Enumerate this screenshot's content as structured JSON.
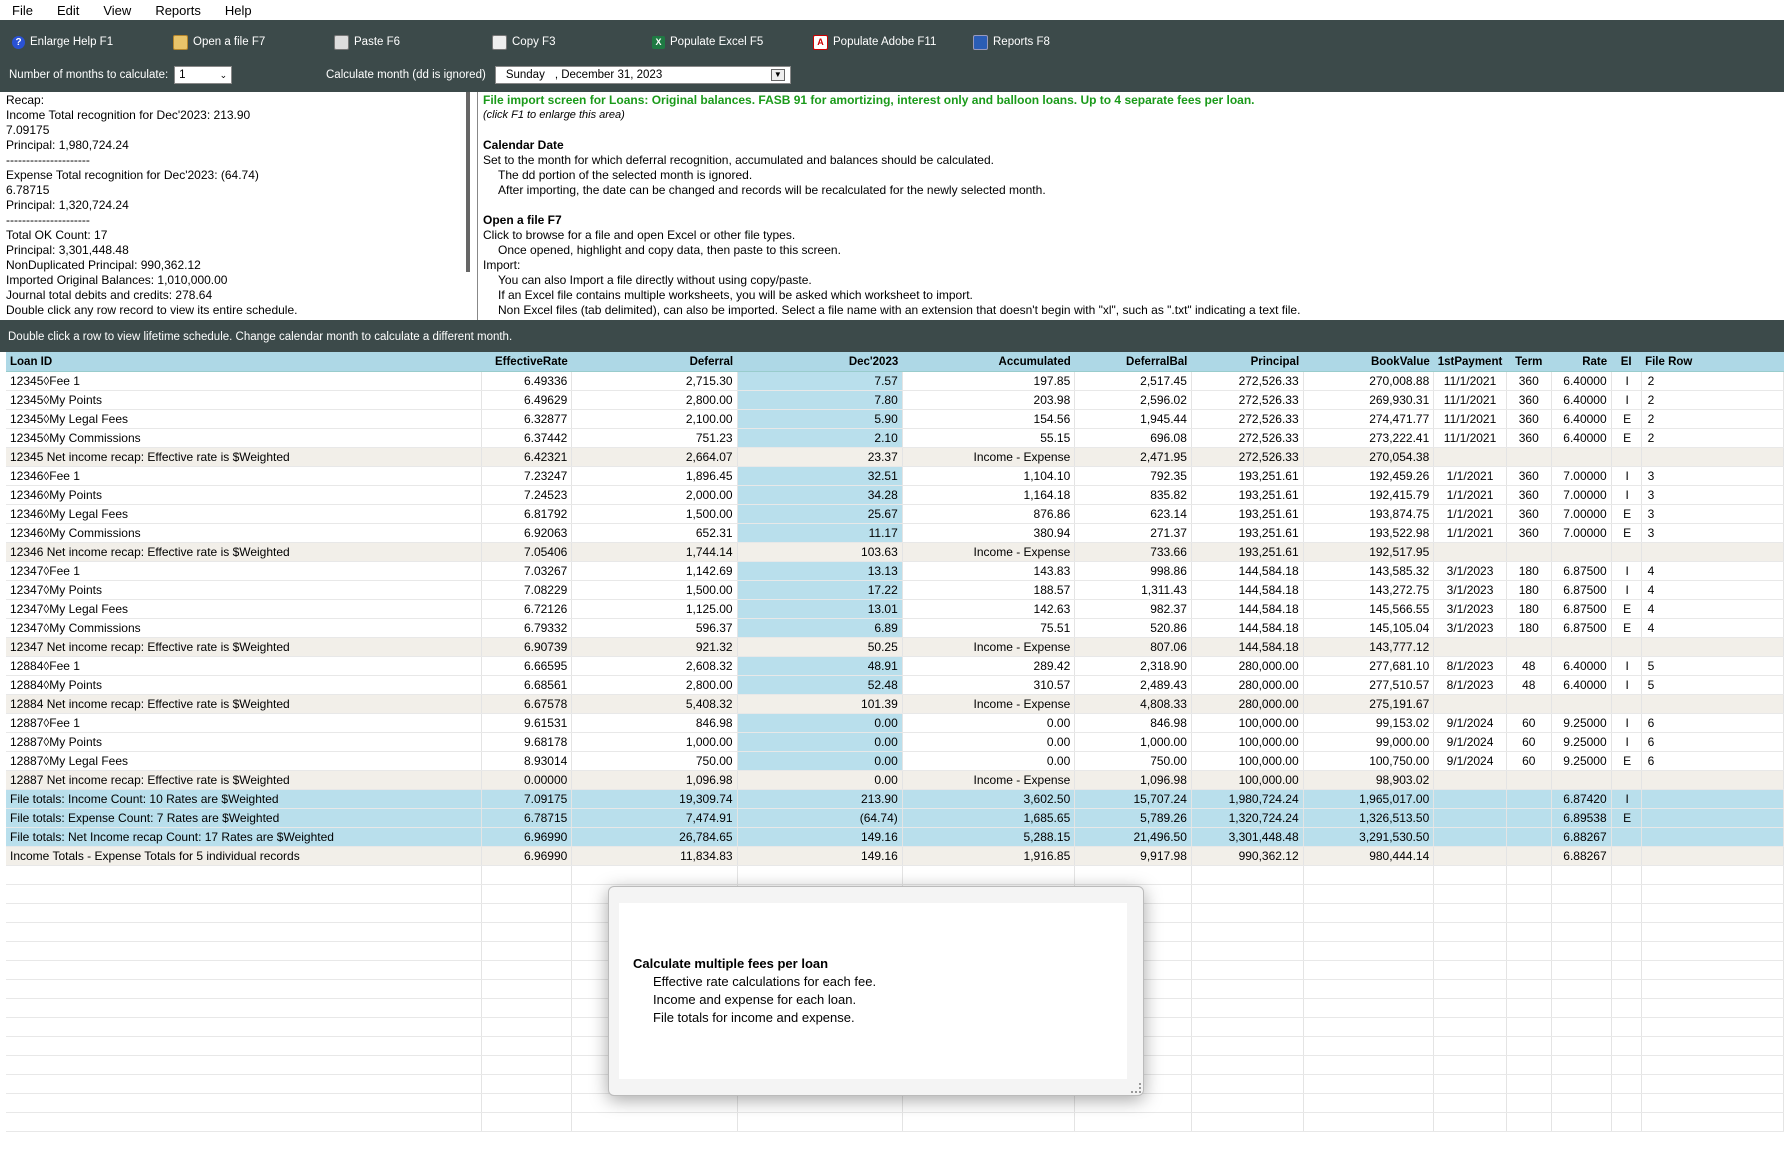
{
  "menu": [
    "File",
    "Edit",
    "View",
    "Reports",
    "Help"
  ],
  "toolbar": {
    "buttons": [
      {
        "label": "Enlarge Help  F1",
        "icon": "help-icon"
      },
      {
        "label": "Open a file  F7",
        "icon": "folder-icon"
      },
      {
        "label": "Paste  F6",
        "icon": "paste-icon"
      },
      {
        "label": "Copy  F3",
        "icon": "copy-icon"
      },
      {
        "label": "Populate Excel  F5",
        "icon": "excel-icon"
      },
      {
        "label": "Populate Adobe  F11",
        "icon": "pdf-icon"
      },
      {
        "label": "Reports  F8",
        "icon": "reports-icon"
      }
    ],
    "months_label": "Number of months to calculate:",
    "months_value": "1",
    "calc_month_label": "Calculate month (dd is ignored)",
    "calc_month_day": "Sunday",
    "calc_month_date": ", December 31, 2023"
  },
  "recap": [
    "Recap:",
    "Income Total recognition for Dec'2023: 213.90",
    "7.09175",
    "Principal: 1,980,724.24",
    "---------------------",
    "Expense Total recognition for Dec'2023: (64.74)",
    "6.78715",
    "Principal: 1,320,724.24",
    "---------------------",
    "Total OK Count: 17",
    "Principal: 3,301,448.48",
    "NonDuplicated Principal: 990,362.12",
    "Imported Original Balances: 1,010,000.00",
    "Journal total debits and credits: 278.64",
    "Double click any row record to view its entire schedule."
  ],
  "info": {
    "title": "File import screen for Loans:  Original balances.  FASB 91 for amortizing, interest only and balloon loans.  Up to 4 separate fees per loan.",
    "subtitle": "(click F1 to enlarge this area)",
    "cal_head": "Calendar Date",
    "cal_1": "Set to the month for which deferral recognition, accumulated and balances should be calculated.",
    "cal_2": "The dd portion of the selected month is ignored.",
    "cal_3": "After importing, the date can be changed and records will be recalculated for the newly selected month.",
    "open_head": "Open a file  F7",
    "open_1": "Click to browse for a file and open Excel or other file types.",
    "open_2": "Once opened, highlight and copy data, then paste to this screen.",
    "imp_head": "Import:",
    "imp_1": "You can also Import a file directly without using copy/paste.",
    "imp_2": "If an Excel file contains multiple worksheets, you will be asked which worksheet to import.",
    "imp_3": "Non Excel files (tab delimited), can also be imported.  Select a file name with an extension that doesn't begin with \"xl\", such as \".txt\" indicating a text file."
  },
  "status_text": "Double click a row to view lifetime schedule.  Change calendar month to calculate a different month.",
  "columns": [
    "Loan ID",
    "EffectiveRate",
    "Deferral",
    "Dec'2023",
    "Accumulated",
    "DeferralBal",
    "Principal",
    "BookValue",
    "1stPayment",
    "Term",
    "Rate",
    "EI",
    "File Row"
  ],
  "rows": [
    {
      "type": "data",
      "c": [
        "12345◊Fee 1",
        "6.49336",
        "2,715.30",
        "7.57",
        "197.85",
        "2,517.45",
        "272,526.33",
        "270,008.88",
        "11/1/2021",
        "360",
        "6.40000",
        "I",
        "2"
      ]
    },
    {
      "type": "data",
      "c": [
        "12345◊My Points",
        "6.49629",
        "2,800.00",
        "7.80",
        "203.98",
        "2,596.02",
        "272,526.33",
        "269,930.31",
        "11/1/2021",
        "360",
        "6.40000",
        "I",
        "2"
      ]
    },
    {
      "type": "data",
      "c": [
        "12345◊My Legal Fees",
        "6.32877",
        "2,100.00",
        "5.90",
        "154.56",
        "1,945.44",
        "272,526.33",
        "274,471.77",
        "11/1/2021",
        "360",
        "6.40000",
        "E",
        "2"
      ]
    },
    {
      "type": "data",
      "c": [
        "12345◊My Commissions",
        "6.37442",
        "751.23",
        "2.10",
        "55.15",
        "696.08",
        "272,526.33",
        "273,222.41",
        "11/1/2021",
        "360",
        "6.40000",
        "E",
        "2"
      ]
    },
    {
      "type": "recap",
      "c": [
        "12345 Net income recap: Effective rate is $Weighted",
        "6.42321",
        "2,664.07",
        "23.37",
        "Income - Expense",
        "2,471.95",
        "272,526.33",
        "270,054.38",
        "",
        "",
        "",
        "",
        ""
      ]
    },
    {
      "type": "data",
      "c": [
        "12346◊Fee 1",
        "7.23247",
        "1,896.45",
        "32.51",
        "1,104.10",
        "792.35",
        "193,251.61",
        "192,459.26",
        "1/1/2021",
        "360",
        "7.00000",
        "I",
        "3"
      ]
    },
    {
      "type": "data",
      "c": [
        "12346◊My Points",
        "7.24523",
        "2,000.00",
        "34.28",
        "1,164.18",
        "835.82",
        "193,251.61",
        "192,415.79",
        "1/1/2021",
        "360",
        "7.00000",
        "I",
        "3"
      ]
    },
    {
      "type": "data",
      "c": [
        "12346◊My Legal Fees",
        "6.81792",
        "1,500.00",
        "25.67",
        "876.86",
        "623.14",
        "193,251.61",
        "193,874.75",
        "1/1/2021",
        "360",
        "7.00000",
        "E",
        "3"
      ]
    },
    {
      "type": "data",
      "c": [
        "12346◊My Commissions",
        "6.92063",
        "652.31",
        "11.17",
        "380.94",
        "271.37",
        "193,251.61",
        "193,522.98",
        "1/1/2021",
        "360",
        "7.00000",
        "E",
        "3"
      ]
    },
    {
      "type": "recap",
      "c": [
        "12346 Net income recap: Effective rate is $Weighted",
        "7.05406",
        "1,744.14",
        "103.63",
        "Income - Expense",
        "733.66",
        "193,251.61",
        "192,517.95",
        "",
        "",
        "",
        "",
        ""
      ]
    },
    {
      "type": "data",
      "c": [
        "12347◊Fee 1",
        "7.03267",
        "1,142.69",
        "13.13",
        "143.83",
        "998.86",
        "144,584.18",
        "143,585.32",
        "3/1/2023",
        "180",
        "6.87500",
        "I",
        "4"
      ]
    },
    {
      "type": "data",
      "c": [
        "12347◊My Points",
        "7.08229",
        "1,500.00",
        "17.22",
        "188.57",
        "1,311.43",
        "144,584.18",
        "143,272.75",
        "3/1/2023",
        "180",
        "6.87500",
        "I",
        "4"
      ]
    },
    {
      "type": "data",
      "c": [
        "12347◊My Legal Fees",
        "6.72126",
        "1,125.00",
        "13.01",
        "142.63",
        "982.37",
        "144,584.18",
        "145,566.55",
        "3/1/2023",
        "180",
        "6.87500",
        "E",
        "4"
      ]
    },
    {
      "type": "data",
      "c": [
        "12347◊My Commissions",
        "6.79332",
        "596.37",
        "6.89",
        "75.51",
        "520.86",
        "144,584.18",
        "145,105.04",
        "3/1/2023",
        "180",
        "6.87500",
        "E",
        "4"
      ]
    },
    {
      "type": "recap",
      "c": [
        "12347 Net income recap: Effective rate is $Weighted",
        "6.90739",
        "921.32",
        "50.25",
        "Income - Expense",
        "807.06",
        "144,584.18",
        "143,777.12",
        "",
        "",
        "",
        "",
        ""
      ]
    },
    {
      "type": "data",
      "c": [
        "12884◊Fee 1",
        "6.66595",
        "2,608.32",
        "48.91",
        "289.42",
        "2,318.90",
        "280,000.00",
        "277,681.10",
        "8/1/2023",
        "48",
        "6.40000",
        "I",
        "5"
      ]
    },
    {
      "type": "data",
      "c": [
        "12884◊My Points",
        "6.68561",
        "2,800.00",
        "52.48",
        "310.57",
        "2,489.43",
        "280,000.00",
        "277,510.57",
        "8/1/2023",
        "48",
        "6.40000",
        "I",
        "5"
      ]
    },
    {
      "type": "recap",
      "c": [
        "12884 Net income recap: Effective rate is $Weighted",
        "6.67578",
        "5,408.32",
        "101.39",
        "Income - Expense",
        "4,808.33",
        "280,000.00",
        "275,191.67",
        "",
        "",
        "",
        "",
        ""
      ]
    },
    {
      "type": "data",
      "c": [
        "12887◊Fee 1",
        "9.61531",
        "846.98",
        "0.00",
        "0.00",
        "846.98",
        "100,000.00",
        "99,153.02",
        "9/1/2024",
        "60",
        "9.25000",
        "I",
        "6"
      ]
    },
    {
      "type": "data",
      "c": [
        "12887◊My Points",
        "9.68178",
        "1,000.00",
        "0.00",
        "0.00",
        "1,000.00",
        "100,000.00",
        "99,000.00",
        "9/1/2024",
        "60",
        "9.25000",
        "I",
        "6"
      ]
    },
    {
      "type": "data",
      "c": [
        "12887◊My Legal Fees",
        "8.93014",
        "750.00",
        "0.00",
        "0.00",
        "750.00",
        "100,000.00",
        "100,750.00",
        "9/1/2024",
        "60",
        "9.25000",
        "E",
        "6"
      ]
    },
    {
      "type": "recap",
      "c": [
        "12887 Net income recap: Effective rate is $Weighted",
        "0.00000",
        "1,096.98",
        "0.00",
        "Income - Expense",
        "1,096.98",
        "100,000.00",
        "98,903.02",
        "",
        "",
        "",
        "",
        ""
      ]
    },
    {
      "type": "total",
      "c": [
        "File totals: Income   Count: 10   Rates are $Weighted",
        "7.09175",
        "19,309.74",
        "213.90",
        "3,602.50",
        "15,707.24",
        "1,980,724.24",
        "1,965,017.00",
        "",
        "",
        "6.87420",
        "I",
        ""
      ]
    },
    {
      "type": "total",
      "c": [
        "File totals: Expense   Count: 7   Rates are $Weighted",
        "6.78715",
        "7,474.91",
        "(64.74)",
        "1,685.65",
        "5,789.26",
        "1,320,724.24",
        "1,326,513.50",
        "",
        "",
        "6.89538",
        "E",
        ""
      ]
    },
    {
      "type": "total",
      "c": [
        "File totals: Net Income recap   Count: 17   Rates are $Weighted",
        "6.96990",
        "26,784.65",
        "149.16",
        "5,288.15",
        "21,496.50",
        "3,301,448.48",
        "3,291,530.50",
        "",
        "",
        "6.88267",
        "",
        ""
      ]
    },
    {
      "type": "ie",
      "c": [
        "Income Totals - Expense Totals for 5 individual records",
        "6.96990",
        "11,834.83",
        "149.16",
        "1,916.85",
        "9,917.98",
        "990,362.12",
        "980,444.14",
        "",
        "",
        "6.88267",
        "",
        ""
      ]
    }
  ],
  "popup": {
    "title": "Calculate multiple fees per loan",
    "lines": [
      "Effective rate calculations for each fee.",
      "Income and expense for each loan.",
      "File totals for income and expense."
    ]
  }
}
